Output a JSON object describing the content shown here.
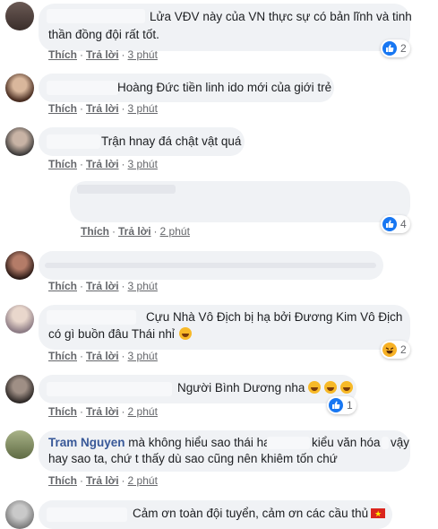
{
  "labels": {
    "like": "Thích",
    "reply": "Trả lời",
    "sep": "·"
  },
  "colors": {
    "bubble": "#f0f2f5",
    "link": "#385898",
    "like": "#1877f2",
    "haha": "#f7b125"
  },
  "comments": [
    {
      "line1": "Lửa VĐV này của VN thực sự có bản lĩnh và tinh",
      "line2": "thần đồng đội rất tốt.",
      "time": "3 phút",
      "reaction": {
        "icon": "like-icon",
        "count": "2"
      }
    },
    {
      "line1": "Hoàng Đức tiền linh ido mới của giới trẻ",
      "time": "3 phút"
    },
    {
      "line1": "Trận hnay đá chật vật quá",
      "time": "3 phút"
    },
    {
      "line1": "",
      "time": "2 phút",
      "reaction": {
        "icon": "like-icon",
        "count": "4"
      }
    },
    {
      "line1": "",
      "time": "3 phút"
    },
    {
      "line1": "Cựu Nhà Vô Địch bị hạ bởi Đương Kim Vô Địch",
      "line2": "có gì buồn đâu Thái nhỉ",
      "time": "3 phút",
      "emoji": "laugh-emoji",
      "reaction": {
        "icon": "haha-icon",
        "count": "2"
      }
    },
    {
      "line1": "Người Bình Dương nha",
      "time": "2 phút",
      "emoji": "laugh-emoji",
      "reaction": {
        "icon": "like-icon",
        "count": "1"
      }
    },
    {
      "name": "Tram Nguyen",
      "line1": "mà không hiểu sao thái hay",
      "line1b": "kiểu văn hóa",
      "line1c": "vậy",
      "line2": "hay sao ta, chứ t thấy dù sao cũng nên khiêm tốn chứ",
      "time": "2 phút"
    },
    {
      "line1": "Cảm ơn toàn đội tuyển, cảm ơn các cầu thủ",
      "emoji": "vietnam-flag"
    }
  ]
}
